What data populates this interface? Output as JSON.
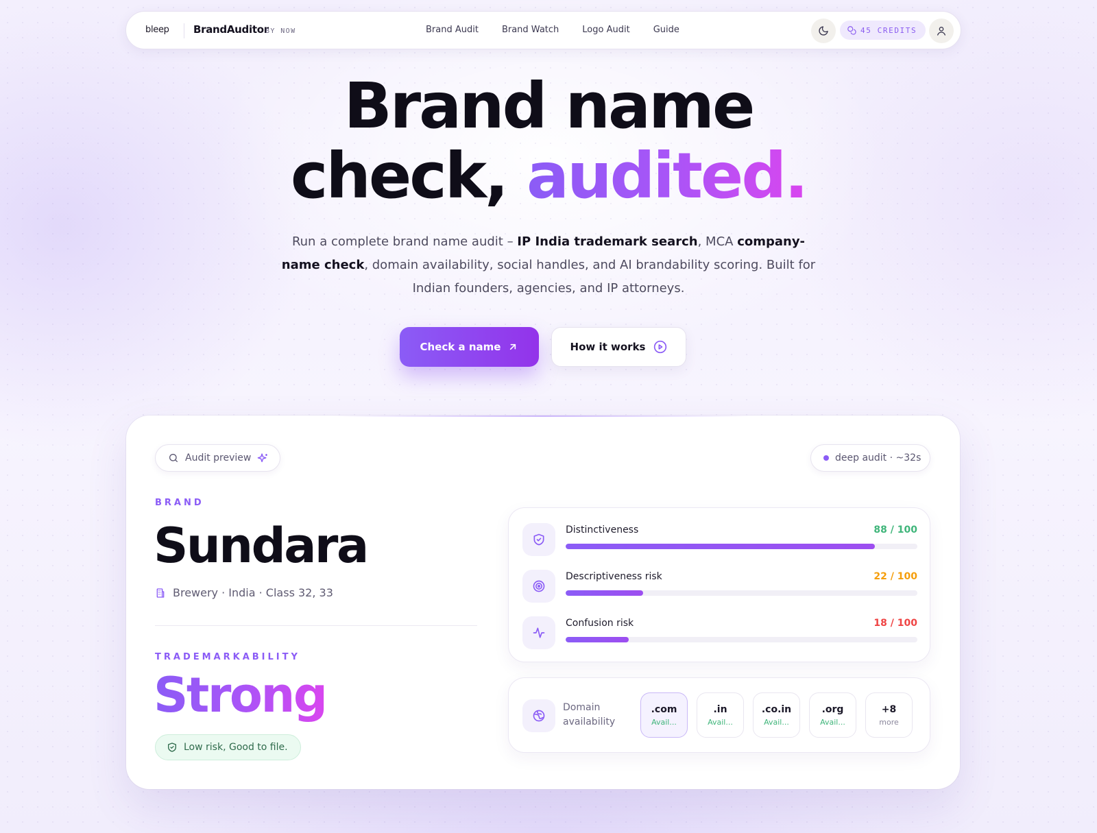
{
  "nav": {
    "logo": "bleep",
    "brand": "BrandAuditor",
    "by": "BY NOW",
    "links": [
      "Brand Audit",
      "Brand Watch",
      "Logo Audit",
      "Guide"
    ],
    "credits": "45 CREDITS"
  },
  "hero": {
    "title_line1": "Brand name",
    "title_line2_a": "check, ",
    "title_line2_b": "audited.",
    "sub_1": "Run a complete brand name audit – ",
    "sub_bold1": "IP India trademark search",
    "sub_2": ", MCA ",
    "sub_bold2": "company-name check",
    "sub_3": ", domain availability, social handles, and AI brandability scoring. Built for Indian founders, agencies, and IP attorneys.",
    "cta_primary": "Check a name",
    "cta_secondary": "How it works"
  },
  "preview": {
    "pill_left": "Audit preview",
    "pill_right": "deep audit · ~32s",
    "brand_eyebrow": "BRAND",
    "brand_name": "Sundara",
    "brand_meta": "Brewery · India · Class 32, 33",
    "tm_eyebrow": "TRADEMARKABILITY",
    "tm_value": "Strong",
    "risk_badge": "Low risk, Good to file.",
    "scores": [
      {
        "label": "Distinctiveness",
        "value_text": "88 / 100",
        "value": 88,
        "color": "#3fb57a"
      },
      {
        "label": "Descriptiveness risk",
        "value_text": "22 / 100",
        "value": 22,
        "color": "#f59e0b"
      },
      {
        "label": "Confusion risk",
        "value_text": "18 / 100",
        "value": 18,
        "color": "#ef4444"
      }
    ],
    "domain_label": "Domain availability",
    "domains": [
      {
        "name": ".com",
        "status": "Avail..."
      },
      {
        "name": ".in",
        "status": "Avail..."
      },
      {
        "name": ".co.in",
        "status": "Avail..."
      },
      {
        "name": ".org",
        "status": "Avail..."
      },
      {
        "name": "+8",
        "status": "more"
      }
    ]
  },
  "colors": {
    "accent": "#8b5cf6",
    "accent_pink": "#d946ef",
    "success": "#3fb57a",
    "warning": "#f59e0b",
    "danger": "#ef4444"
  }
}
